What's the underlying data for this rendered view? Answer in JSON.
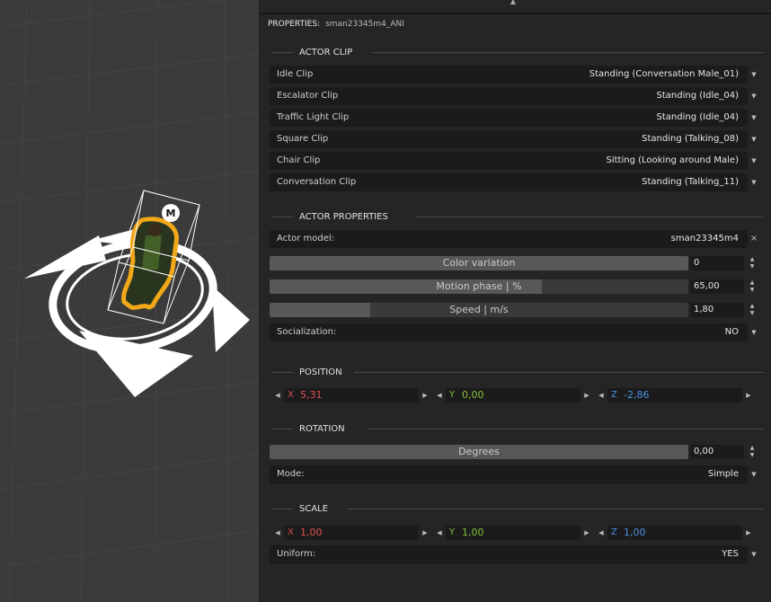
{
  "header": {
    "label": "PROPERTIES:",
    "object_name": "sman23345m4_ANI"
  },
  "viewport": {
    "marker_letter": "M"
  },
  "actor_clip": {
    "title": "ACTOR CLIP",
    "rows": [
      {
        "label": "Idle Clip",
        "value": "Standing (Conversation Male_01)"
      },
      {
        "label": "Escalator Clip",
        "value": "Standing (Idle_04)"
      },
      {
        "label": "Traffic Light Clip",
        "value": "Standing (Idle_04)"
      },
      {
        "label": "Square Clip",
        "value": "Standing (Talking_08)"
      },
      {
        "label": "Chair Clip",
        "value": "Sitting (Looking around Male)"
      },
      {
        "label": "Conversation Clip",
        "value": "Standing (Talking_11)"
      }
    ]
  },
  "actor_properties": {
    "title": "ACTOR PROPERTIES",
    "actor_model": {
      "label": "Actor model:",
      "value": "sman23345m4"
    },
    "color_variation": {
      "label": "Color variation",
      "value": "0",
      "fraction": 1.0
    },
    "motion_phase": {
      "label": "Motion phase | %",
      "value": "65,00",
      "fraction": 0.65
    },
    "speed": {
      "label": "Speed | m/s",
      "value": "1,80",
      "fraction": 0.24
    },
    "socialization": {
      "label": "Socialization:",
      "value": "NO"
    }
  },
  "position": {
    "title": "POSITION",
    "x": "5,31",
    "y": "0,00",
    "z": "-2,86"
  },
  "rotation": {
    "title": "ROTATION",
    "degrees": {
      "label": "Degrees",
      "value": "0,00",
      "fraction": 1.0
    },
    "mode": {
      "label": "Mode:",
      "value": "Simple"
    }
  },
  "scale": {
    "title": "SCALE",
    "x": "1,00",
    "y": "1,00",
    "z": "1,00",
    "uniform": {
      "label": "Uniform:",
      "value": "YES"
    }
  },
  "axis_labels": {
    "x": "X",
    "y": "Y",
    "z": "Z"
  },
  "colors": {
    "axis_x": "#e05050",
    "axis_y": "#86c33a",
    "axis_z": "#4a8fe0",
    "actor_outline": "#f0a818"
  },
  "icons": {
    "dropdown": "chevron-down-icon",
    "clear": "close-icon",
    "spinner": "spinner-icon",
    "step_left": "triangle-left-icon",
    "step_right": "triangle-right-icon"
  }
}
